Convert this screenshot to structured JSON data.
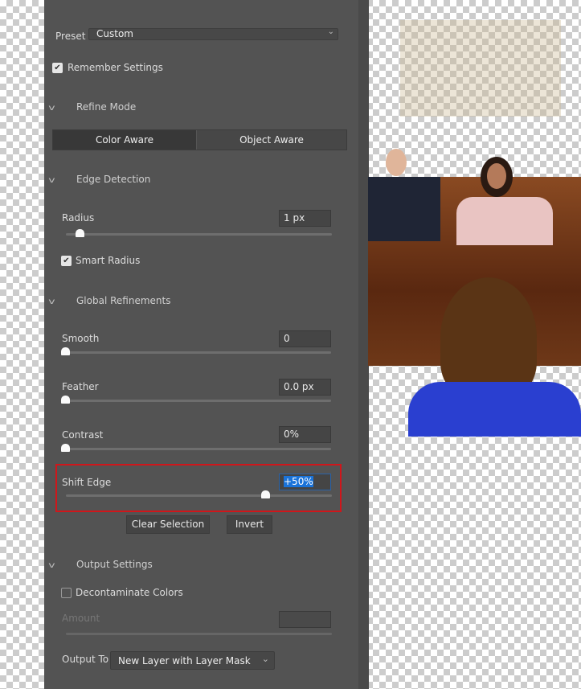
{
  "preset": {
    "label": "Preset",
    "value": "Custom"
  },
  "remember_settings": {
    "label": "Remember Settings",
    "checked": true
  },
  "refine_mode": {
    "title": "Refine Mode",
    "options": [
      "Color Aware",
      "Object Aware"
    ],
    "selected": "Color Aware"
  },
  "edge_detection": {
    "title": "Edge Detection",
    "radius_label": "Radius",
    "radius_value": "1 px",
    "radius_fraction": 0.05,
    "smart_radius_label": "Smart Radius",
    "smart_radius_checked": true
  },
  "global_refinements": {
    "title": "Global Refinements",
    "smooth": {
      "label": "Smooth",
      "value": "0",
      "fraction": 0
    },
    "feather": {
      "label": "Feather",
      "value": "0.0 px",
      "fraction": 0
    },
    "contrast": {
      "label": "Contrast",
      "value": "0%",
      "fraction": 0
    },
    "shift_edge": {
      "label": "Shift Edge",
      "value": "+50%",
      "fraction": 0.75
    }
  },
  "buttons": {
    "clear_selection": "Clear Selection",
    "invert": "Invert"
  },
  "output_settings": {
    "title": "Output Settings",
    "decontaminate_label": "Decontaminate Colors",
    "decontaminate_checked": false,
    "amount_label": "Amount",
    "output_to_label": "Output To",
    "output_to_value": "New Layer with Layer Mask"
  },
  "colors": {
    "panel": "#535353",
    "highlight": "#d0161b",
    "selection": "#1a73d9"
  }
}
